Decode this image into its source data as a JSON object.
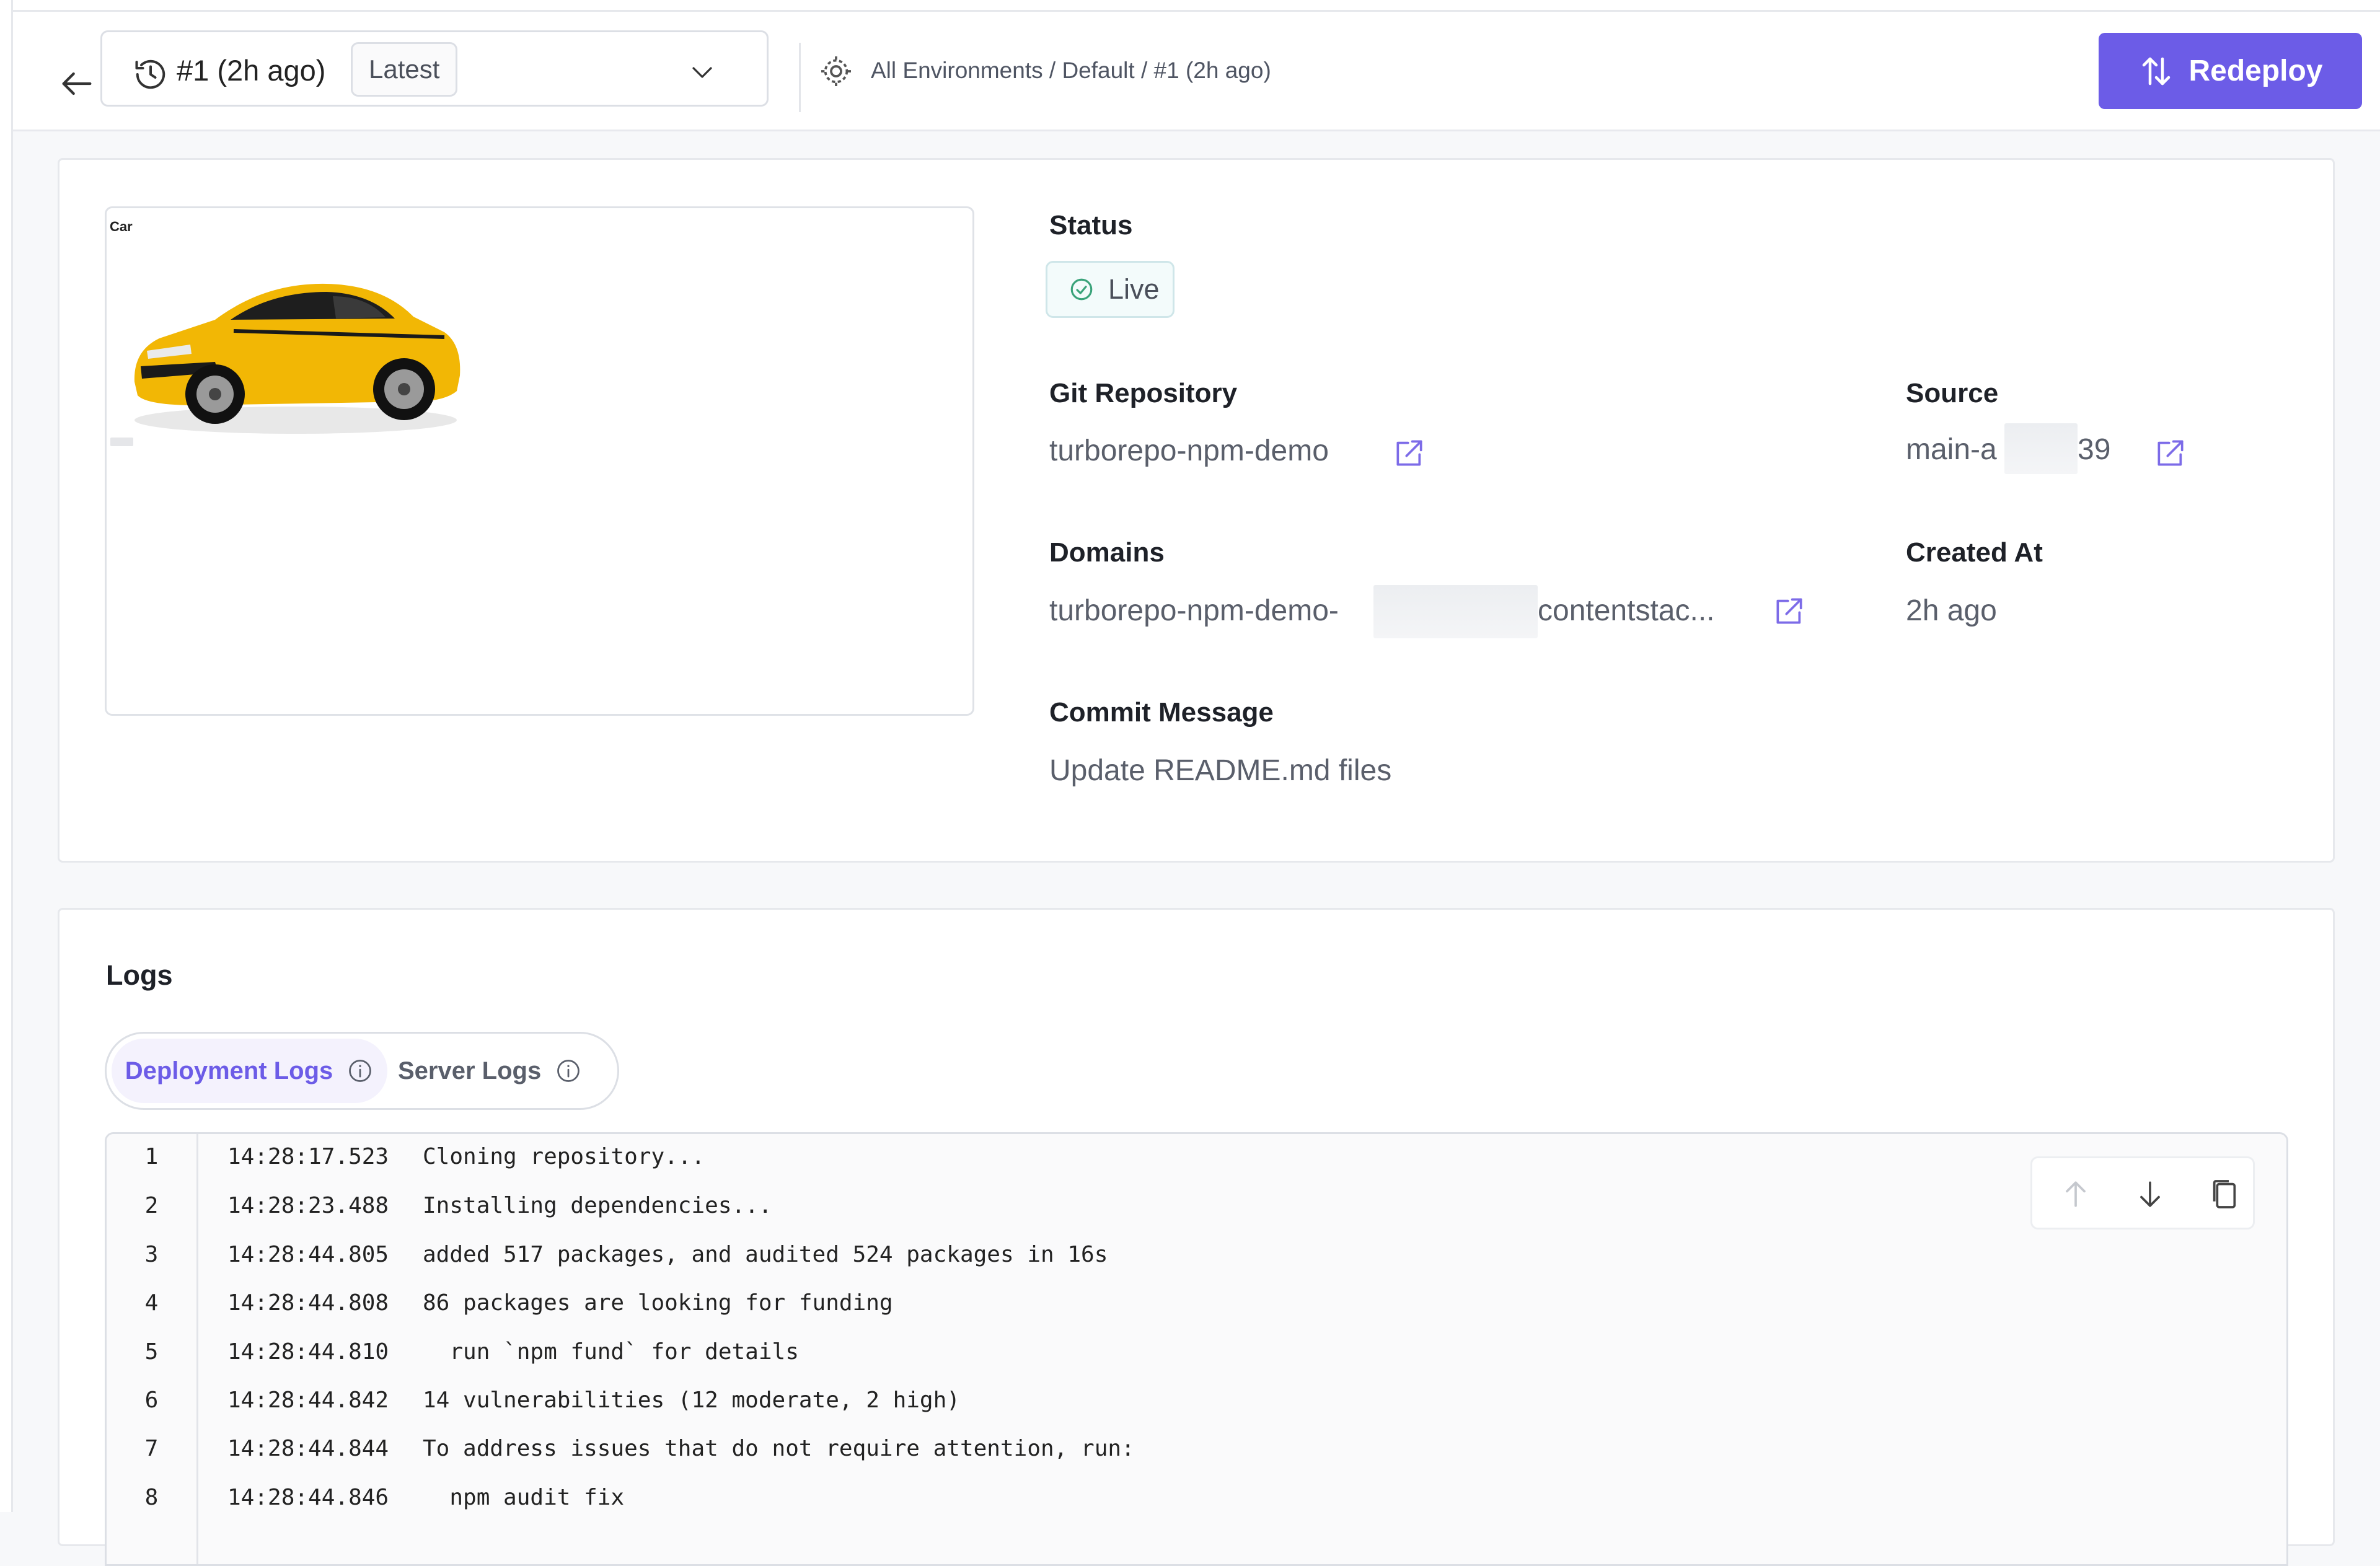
{
  "header": {
    "deployment_title": "#1 (2h ago)",
    "latest_label": "Latest",
    "breadcrumb": "All Environments / Default / #1 (2h ago)",
    "redeploy_label": "Redeploy"
  },
  "preview": {
    "caption": "Car"
  },
  "details": {
    "status_label": "Status",
    "status_value": "Live",
    "git_repo_label": "Git Repository",
    "git_repo_value": "turborepo-npm-demo",
    "source_label": "Source",
    "source_prefix": "main-a",
    "source_suffix": "39",
    "domains_label": "Domains",
    "domain_prefix": "turborepo-npm-demo-",
    "domain_suffix": "contentstac...",
    "created_at_label": "Created At",
    "created_at_value": "2h ago",
    "commit_label": "Commit Message",
    "commit_value": "Update README.md files"
  },
  "logs": {
    "title": "Logs",
    "tabs": [
      {
        "label": "Deployment Logs",
        "active": true
      },
      {
        "label": "Server Logs",
        "active": false
      }
    ],
    "lines": [
      {
        "n": "1",
        "time": "14:28:17.523",
        "text": "Cloning repository..."
      },
      {
        "n": "2",
        "time": "14:28:23.488",
        "text": "Installing dependencies..."
      },
      {
        "n": "3",
        "time": "14:28:44.805",
        "text": "added 517 packages, and audited 524 packages in 16s"
      },
      {
        "n": "4",
        "time": "14:28:44.808",
        "text": "86 packages are looking for funding"
      },
      {
        "n": "5",
        "time": "14:28:44.810",
        "text": "  run `npm fund` for details"
      },
      {
        "n": "6",
        "time": "14:28:44.842",
        "text": "14 vulnerabilities (12 moderate, 2 high)"
      },
      {
        "n": "7",
        "time": "14:28:44.844",
        "text": "To address issues that do not require attention, run:"
      },
      {
        "n": "8",
        "time": "14:28:44.846",
        "text": "  npm audit fix"
      }
    ]
  },
  "colors": {
    "accent": "#6c5ce7",
    "live_green": "#3aa37a"
  }
}
